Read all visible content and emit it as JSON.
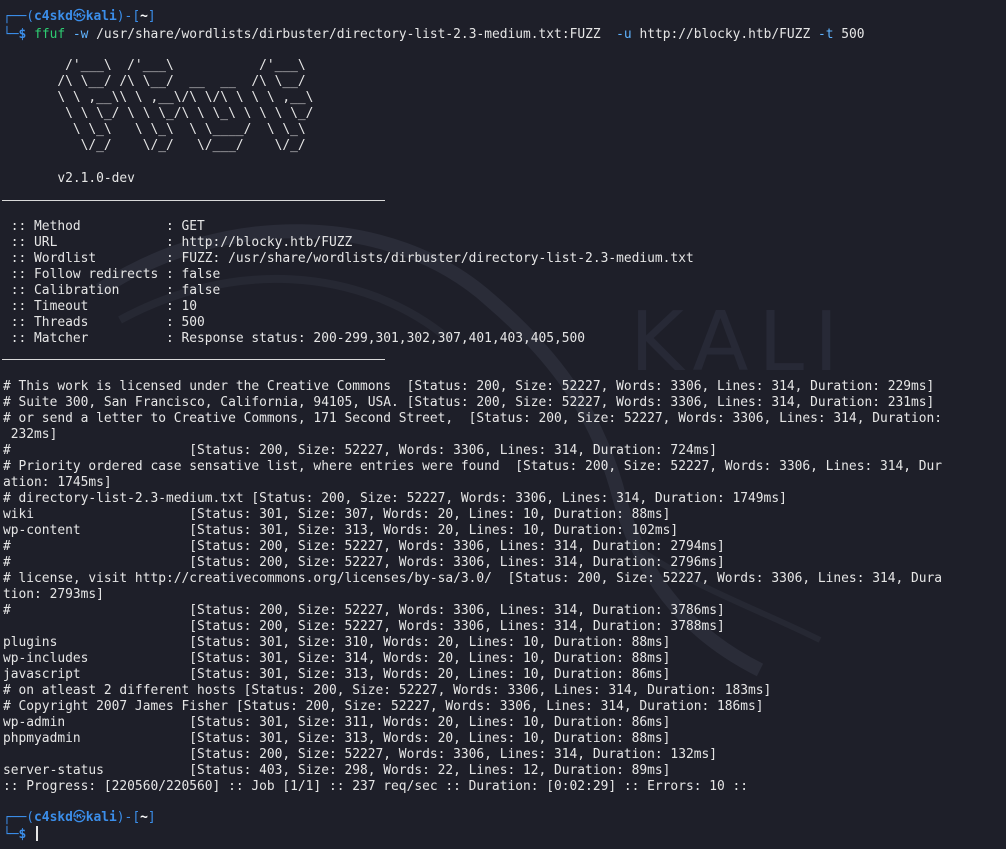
{
  "prompt": {
    "top_left": "┌──(",
    "user": "c4skd",
    "skull": "㉿",
    "host": "kali",
    "sep": ")-[",
    "dir": "~",
    "end": "]",
    "bottom_left": "└─",
    "dollar": "$"
  },
  "command": {
    "binary": "ffuf",
    "flag_w": "-w",
    "wordlist": "/usr/share/wordlists/dirbuster/directory-list-2.3-medium.txt:FUZZ",
    "flag_u": "-u",
    "url": "http://blocky.htb/FUZZ",
    "flag_t": "-t",
    "threads": "500"
  },
  "banner": [
    "        /'___\\  /'___\\           /'___\\       ",
    "       /\\ \\__/ /\\ \\__/  __  __  /\\ \\__/       ",
    "       \\ \\ ,__\\\\ \\ ,__\\/\\ \\/\\ \\ \\ \\ ,__\\      ",
    "        \\ \\ \\_/ \\ \\ \\_/\\ \\ \\_\\ \\ \\ \\ \\_/      ",
    "         \\ \\_\\   \\ \\_\\  \\ \\____/  \\ \\_\\       ",
    "          \\/_/    \\/_/   \\/___/    \\/_/       "
  ],
  "version": "       v2.1.0-dev",
  "config": [
    " :: Method           : GET",
    " :: URL              : http://blocky.htb/FUZZ",
    " :: Wordlist         : FUZZ: /usr/share/wordlists/dirbuster/directory-list-2.3-medium.txt",
    " :: Follow redirects : false",
    " :: Calibration      : false",
    " :: Timeout          : 10",
    " :: Threads          : 500",
    " :: Matcher          : Response status: 200-299,301,302,307,401,403,405,500"
  ],
  "results": [
    "# This work is licensed under the Creative Commons  [Status: 200, Size: 52227, Words: 3306, Lines: 314, Duration: 229ms]",
    "# Suite 300, San Francisco, California, 94105, USA. [Status: 200, Size: 52227, Words: 3306, Lines: 314, Duration: 231ms]",
    "# or send a letter to Creative Commons, 171 Second Street,  [Status: 200, Size: 52227, Words: 3306, Lines: 314, Duration:",
    " 232ms]",
    "#                       [Status: 200, Size: 52227, Words: 3306, Lines: 314, Duration: 724ms]",
    "# Priority ordered case sensative list, where entries were found  [Status: 200, Size: 52227, Words: 3306, Lines: 314, Dur",
    "ation: 1745ms]",
    "# directory-list-2.3-medium.txt [Status: 200, Size: 52227, Words: 3306, Lines: 314, Duration: 1749ms]",
    "wiki                    [Status: 301, Size: 307, Words: 20, Lines: 10, Duration: 88ms]",
    "wp-content              [Status: 301, Size: 313, Words: 20, Lines: 10, Duration: 102ms]",
    "#                       [Status: 200, Size: 52227, Words: 3306, Lines: 314, Duration: 2794ms]",
    "#                       [Status: 200, Size: 52227, Words: 3306, Lines: 314, Duration: 2796ms]",
    "# license, visit http://creativecommons.org/licenses/by-sa/3.0/  [Status: 200, Size: 52227, Words: 3306, Lines: 314, Dura",
    "tion: 2793ms]",
    "#                       [Status: 200, Size: 52227, Words: 3306, Lines: 314, Duration: 3786ms]",
    "                        [Status: 200, Size: 52227, Words: 3306, Lines: 314, Duration: 3788ms]",
    "plugins                 [Status: 301, Size: 310, Words: 20, Lines: 10, Duration: 88ms]",
    "wp-includes             [Status: 301, Size: 314, Words: 20, Lines: 10, Duration: 88ms]",
    "javascript              [Status: 301, Size: 313, Words: 20, Lines: 10, Duration: 86ms]",
    "# on atleast 2 different hosts [Status: 200, Size: 52227, Words: 3306, Lines: 314, Duration: 183ms]",
    "# Copyright 2007 James Fisher [Status: 200, Size: 52227, Words: 3306, Lines: 314, Duration: 186ms]",
    "wp-admin                [Status: 301, Size: 311, Words: 20, Lines: 10, Duration: 86ms]",
    "phpmyadmin              [Status: 301, Size: 313, Words: 20, Lines: 10, Duration: 88ms]",
    "                        [Status: 200, Size: 52227, Words: 3306, Lines: 314, Duration: 132ms]",
    "server-status           [Status: 403, Size: 298, Words: 22, Lines: 12, Duration: 89ms]",
    ":: Progress: [220560/220560] :: Job [1/1] :: 237 req/sec :: Duration: [0:02:29] :: Errors: 10 ::"
  ],
  "watermark": "KALI",
  "colors": {
    "background": "#1e1f29",
    "prompt_frame": "#3b8eea",
    "command": "#2ecc71",
    "argument": "#5fb3ff",
    "text": "#e6e6e6"
  }
}
